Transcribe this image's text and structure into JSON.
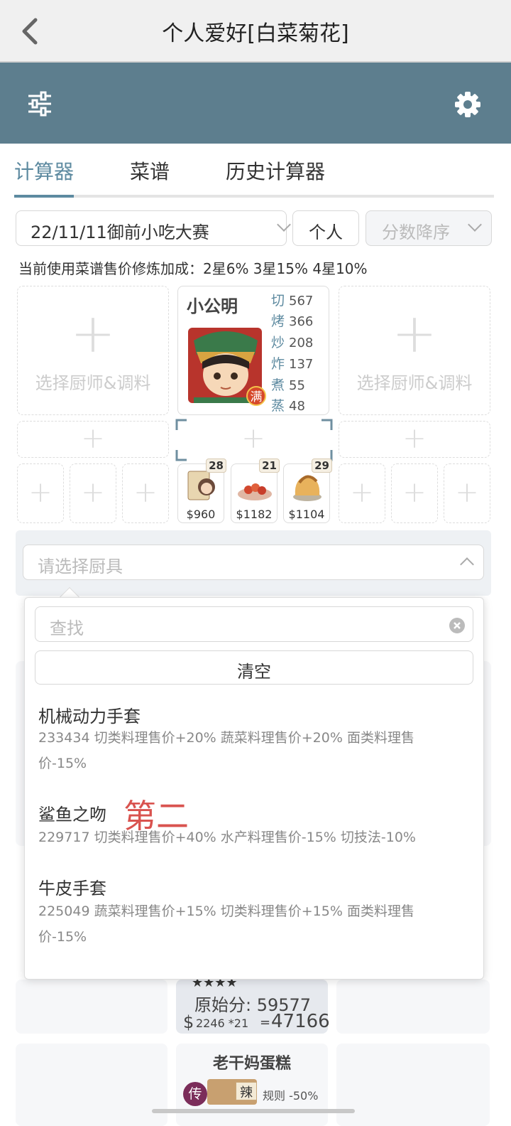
{
  "header": {
    "title": "个人爱好[白菜菊花]"
  },
  "tabs": [
    {
      "label": "计算器"
    },
    {
      "label": "菜谱"
    },
    {
      "label": "历史计算器"
    }
  ],
  "filters": {
    "event": "22/11/11御前小吃大赛",
    "mode": "个人",
    "sort": "分数降序"
  },
  "bonus_note": "当前使用菜谱售价修炼加成：2星6% 3星15% 4星10%",
  "empty_slot_label": "选择厨师&调料",
  "chef": {
    "name": "小公明",
    "badge": "满",
    "stats": [
      {
        "k": "切",
        "v": "567"
      },
      {
        "k": "烤",
        "v": "366"
      },
      {
        "k": "炒",
        "v": "208"
      },
      {
        "k": "炸",
        "v": "137"
      },
      {
        "k": "煮",
        "v": "55"
      },
      {
        "k": "蒸",
        "v": "48"
      }
    ]
  },
  "recipes": [
    {
      "count": "28",
      "price": "$960"
    },
    {
      "count": "21",
      "price": "$1182"
    },
    {
      "count": "29",
      "price": "$1104"
    }
  ],
  "cooker_select": {
    "placeholder": "请选择厨具"
  },
  "dropdown": {
    "search_placeholder": "查找",
    "clear_label": "清空",
    "items": [
      {
        "name": "机械动力手套",
        "desc": "233434 切类料理售价+20% 蔬菜料理售价+20% 面类料理售价-15%"
      },
      {
        "name": "鲨鱼之吻",
        "annotation": "第二",
        "desc": "229717 切类料理售价+40% 水产料理售价-15% 切技法-10%"
      },
      {
        "name": "牛皮手套",
        "desc": "225049 蔬菜料理售价+15% 切类料理售价+15% 面类料理售价-15%"
      }
    ]
  },
  "result_card": {
    "stars": "★★★★",
    "score_label": "原始分: 59577",
    "price_mult": "2246 *21",
    "total": "47166"
  },
  "next_dish": {
    "name": "老干妈蛋糕",
    "badge": "传",
    "tag": "辣",
    "rule": "规则 -50%"
  },
  "colors": {
    "toolbar": "#5d7e8e",
    "accent": "#5d8aa0",
    "annotation_red": "#d9534f"
  }
}
